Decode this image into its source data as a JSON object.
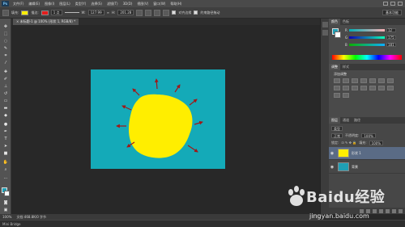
{
  "app": {
    "logo": "Ps"
  },
  "menu": [
    "文件(F)",
    "编辑(E)",
    "图像(I)",
    "图层(L)",
    "类型(Y)",
    "选择(S)",
    "滤镜(T)",
    "3D(D)",
    "视图(V)",
    "窗口(W)",
    "帮助(H)"
  ],
  "options": {
    "fill_label": "填充:",
    "stroke_label": "描边:",
    "stroke_width": "1 点",
    "w_label": "W:",
    "w_value": "127.99",
    "h_label": "H:",
    "h_value": "201.28",
    "align_edges_label": "对齐边缘",
    "constrain_label": "约束路径拖动",
    "workspace": "基本功能",
    "fill_color": "#ffee00",
    "stroke_color": "#e41c1c"
  },
  "document_tab": "未标题-1 @ 100% (形状 1, RGB/8) *",
  "color_panel": {
    "tabs": [
      "颜色",
      "色板"
    ],
    "sliders": [
      {
        "letter": "R",
        "value": "12"
      },
      {
        "letter": "G",
        "value": "175"
      },
      {
        "letter": "B",
        "value": "181"
      }
    ],
    "fg_color": "#1f9fb5"
  },
  "adjustments_panel": {
    "tabs": [
      "调整",
      "样式"
    ],
    "title": "添加调整"
  },
  "layers_panel": {
    "tabs": [
      "图层",
      "通道",
      "路径"
    ],
    "kind_filter": "类型",
    "blend_mode": "正常",
    "opacity_label": "不透明度:",
    "opacity_value": "100%",
    "lock_label": "锁定:",
    "fill_label": "填充:",
    "fill_value": "100%",
    "layers": [
      {
        "name": "形状 1",
        "thumb_color": "#ffee00"
      },
      {
        "name": "背景",
        "thumb_color": "#1f9fb5"
      }
    ]
  },
  "status": {
    "zoom": "100%",
    "doc_size": "文档:468.8K/0 字节"
  },
  "minibar": {
    "label": "Mini Bridge"
  },
  "watermark": {
    "text": "Baidu经验",
    "url": "jingyan.baidu.com"
  }
}
